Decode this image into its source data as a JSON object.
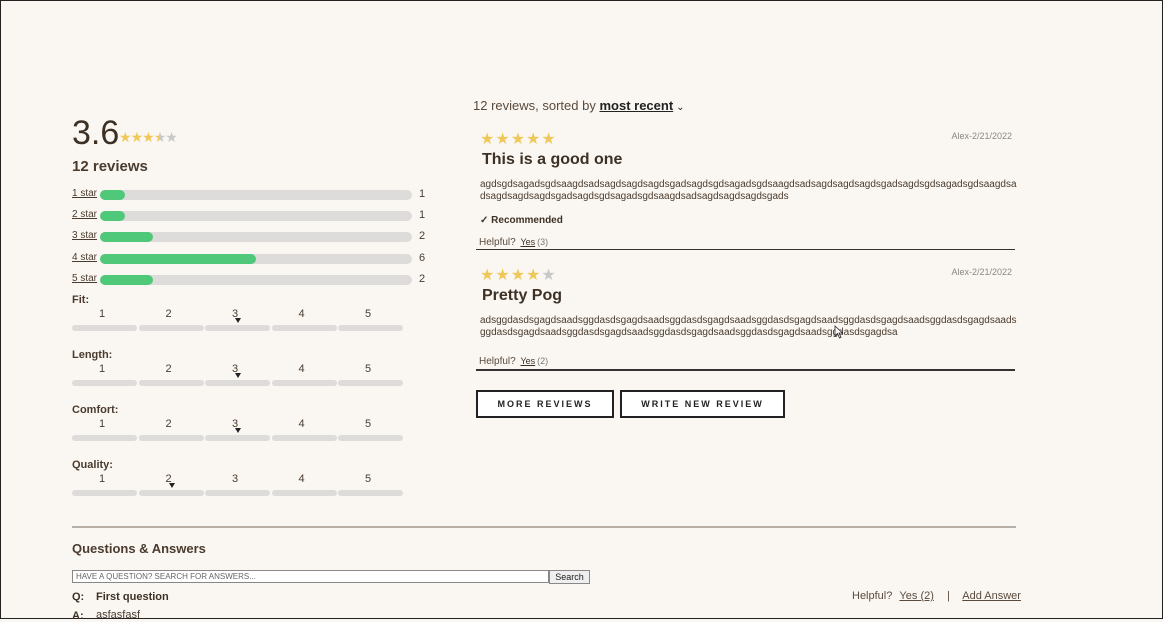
{
  "summary": {
    "average": "3.6",
    "average_value": 3.6,
    "review_count_label": "12 reviews",
    "breakdown": [
      {
        "label": "1 star",
        "count": "1",
        "fraction": 0.08
      },
      {
        "label": "2 star",
        "count": "1",
        "fraction": 0.08
      },
      {
        "label": "3 star",
        "count": "2",
        "fraction": 0.17
      },
      {
        "label": "4 star",
        "count": "6",
        "fraction": 0.5
      },
      {
        "label": "5 star",
        "count": "2",
        "fraction": 0.17
      }
    ]
  },
  "characteristics": [
    {
      "name": "Fit:",
      "scale": [
        "1",
        "2",
        "3",
        "4",
        "5"
      ],
      "selected": 3
    },
    {
      "name": "Length:",
      "scale": [
        "1",
        "2",
        "3",
        "4",
        "5"
      ],
      "selected": 3
    },
    {
      "name": "Comfort:",
      "scale": [
        "1",
        "2",
        "3",
        "4",
        "5"
      ],
      "selected": 3
    },
    {
      "name": "Quality:",
      "scale": [
        "1",
        "2",
        "3",
        "4",
        "5"
      ],
      "selected": 2
    }
  ],
  "sort": {
    "prefix": "12 reviews, sorted by",
    "value": "most recent"
  },
  "reviews": [
    {
      "rating": 5,
      "meta": "Alex-2/21/2022",
      "title": "This is a good one",
      "body": "agdsgdsagadsgdsaagdsadsagdsagdsagdsgadsagdsgdsagadsgdsaagdsadsagdsagdsagdsgadsagdsgdsagadsgdsaagdsadsagdsagdsagdsgadsagdsgdsagadsgdsaagdsadsagdsagdsagdsgads",
      "recommended": "✓ Recommended",
      "helpful_label": "Helpful?",
      "yes_label": "Yes",
      "helpful_count": "(3)"
    },
    {
      "rating": 4,
      "meta": "Alex-2/21/2022",
      "title": "Pretty Pog",
      "body": "adsggdasdsgagdsaadsggdasdsgagdsaadsggdasdsgagdsaadsggdasdsgagdsaadsggdasdsgagdsaadsggdasdsgagdsaadsggdasdsgagdsaadsggdasdsgagdsaadsggdasdsgagdsaadsggdasdsgagdsaadsggdasdsgagdsa",
      "recommended": "",
      "helpful_label": "Helpful?",
      "yes_label": "Yes",
      "helpful_count": "(2)"
    }
  ],
  "buttons": {
    "more_reviews": "MORE REVIEWS",
    "write_review": "WRITE NEW REVIEW"
  },
  "qa": {
    "title": "Questions & Answers",
    "search_placeholder": "HAVE A QUESTION? SEARCH FOR ANSWERS...",
    "search_button": "Search",
    "question_label": "Q:",
    "question_text": "First question",
    "answer_label": "A:",
    "answer_text": "asfasfasf",
    "helpful_label": "Helpful?",
    "yes_label": "Yes",
    "helpful_count": "(2)",
    "separator": "|",
    "add_answer": "Add Answer"
  },
  "colors": {
    "star": "#f0c85a",
    "star_empty": "#c8c8c8",
    "bar_fill": "#4fc87a",
    "bar_track": "#dddcda",
    "background": "#faf7f2"
  }
}
